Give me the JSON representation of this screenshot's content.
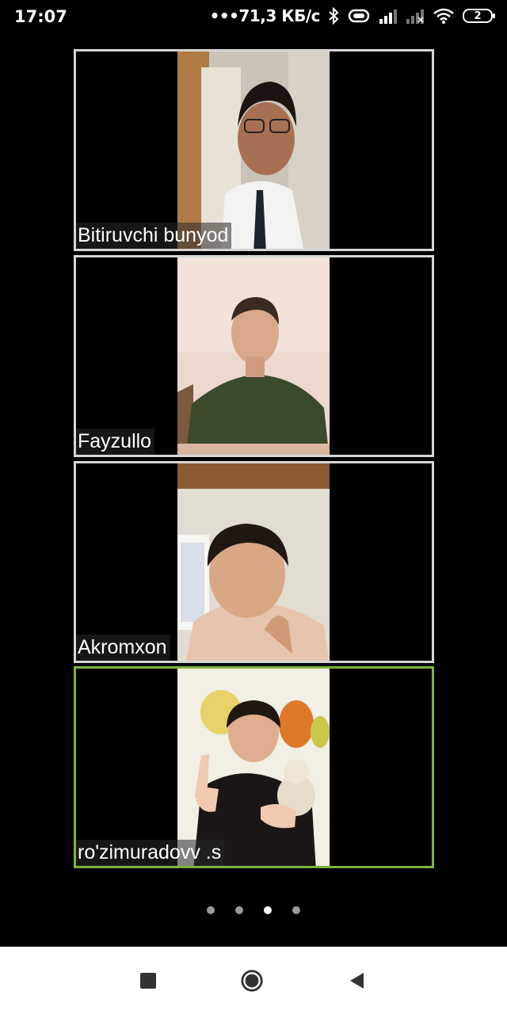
{
  "status_bar": {
    "time": "17:07",
    "network_speed": "•••71,3 КБ/с",
    "battery_level": "2",
    "icons": [
      "bluetooth-icon",
      "vibrate-icon",
      "signal-icon",
      "signal-weak-icon",
      "wifi-icon",
      "battery-icon"
    ]
  },
  "participants": [
    {
      "name": "Bitiruvchi bunyod",
      "active_speaker": false
    },
    {
      "name": "Fayzullo",
      "active_speaker": false
    },
    {
      "name": "Akromxon",
      "active_speaker": false
    },
    {
      "name": "ro'zimuradovv .s",
      "active_speaker": true
    }
  ],
  "pagination": {
    "pages": 4,
    "current": 3
  },
  "colors": {
    "active_border": "#7fb33a",
    "inactive_border": "#d6d6d6",
    "background": "#000000"
  },
  "nav_bar": {
    "icons": [
      "recent-apps-icon",
      "home-icon",
      "back-icon"
    ]
  }
}
